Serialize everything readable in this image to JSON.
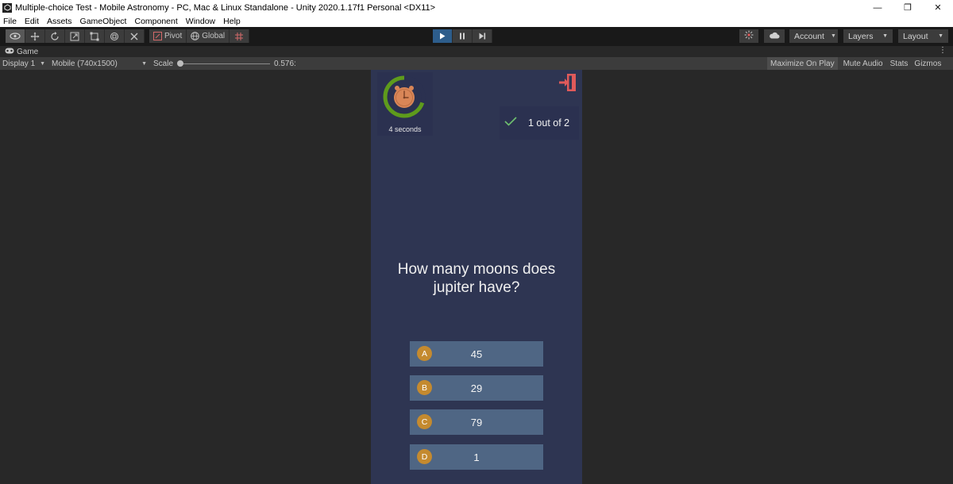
{
  "window": {
    "title": "Multiple-choice Test - Mobile Astronomy - PC, Mac & Linux Standalone - Unity 2020.1.17f1 Personal <DX11>",
    "minimize_glyph": "—",
    "maximize_glyph": "❐",
    "close_glyph": "✕"
  },
  "menu": {
    "items": [
      "File",
      "Edit",
      "Assets",
      "GameObject",
      "Component",
      "Window",
      "Help"
    ]
  },
  "toolbar": {
    "pivot_label": "Pivot",
    "global_label": "Global",
    "account_label": "Account",
    "layers_label": "Layers",
    "layout_label": "Layout",
    "play_color": "#2d5d8c"
  },
  "game_tab": {
    "label": "Game",
    "more_glyph": "⋮"
  },
  "game_bar": {
    "display": "Display 1",
    "resolution": "Mobile (740x1500)",
    "scale_label": "Scale",
    "scale_value": "0.576:",
    "maximize_on_play": "Maximize On Play",
    "mute_audio": "Mute Audio",
    "stats": "Stats",
    "gizmos": "Gizmos"
  },
  "quiz": {
    "timer_text": "4 seconds",
    "timer_fraction_remaining": 0.7,
    "score_text": "1 out of 2",
    "question": "How many moons does jupiter have?",
    "answers": [
      {
        "letter": "A",
        "text": "45"
      },
      {
        "letter": "B",
        "text": "29"
      },
      {
        "letter": "C",
        "text": "79"
      },
      {
        "letter": "D",
        "text": "1"
      }
    ],
    "colors": {
      "background": "#2e3552",
      "answer_bg": "#4f6684",
      "badge": "#c48a2f",
      "timer_ring": "#5e9b1c",
      "exit_icon": "#e05a5a",
      "check": "#6fc06f"
    }
  }
}
